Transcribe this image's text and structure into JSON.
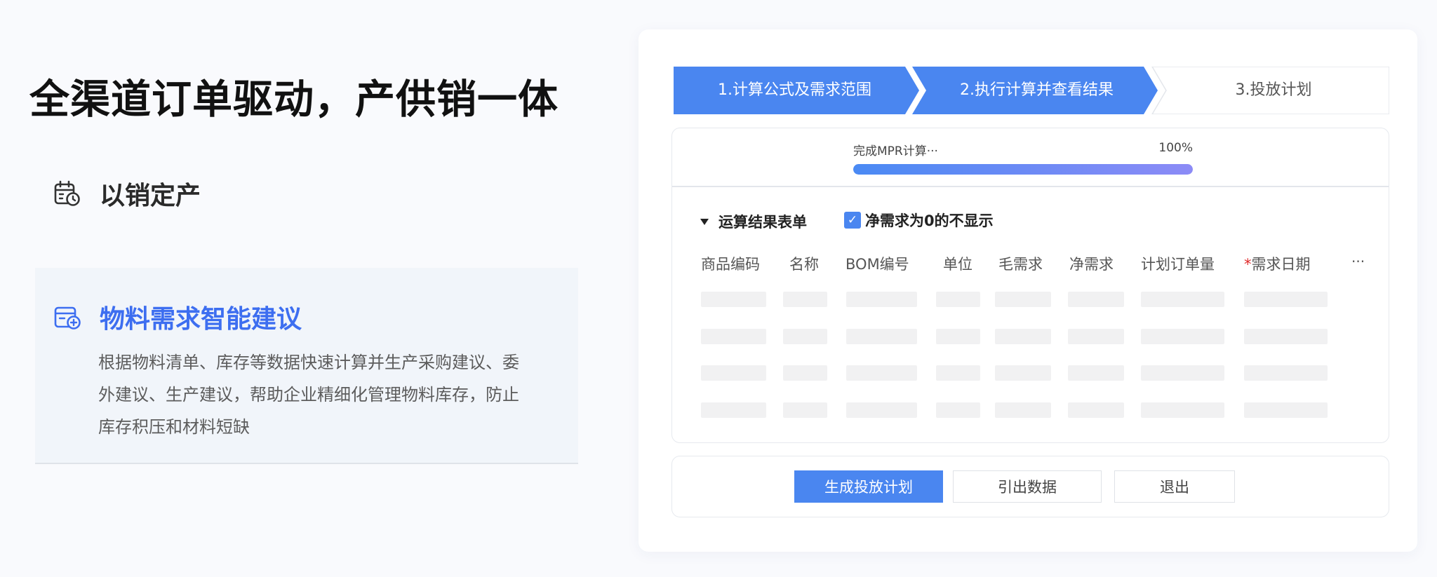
{
  "headline": "全渠道订单驱动，产供销一体",
  "features": [
    {
      "title": "以销定产",
      "icon": "calendar-clock-icon"
    },
    {
      "title": "物料需求智能建议",
      "icon": "calendar-add-icon",
      "desc": "根据物料清单、库存等数据快速计算并生产采购建议、委外建议、生产建议，帮助企业精细化管理物料库存，防止库存积压和材料短缺"
    }
  ],
  "steps": [
    "1.计算公式及需求范围",
    "2.执行计算并查看结果",
    "3.投放计划"
  ],
  "progress": {
    "label": "完成MPR计算···",
    "percent_text": "100%",
    "value": 100
  },
  "results": {
    "title": "运算结果表单",
    "checkbox_label": "净需求为0的不显示",
    "checkbox_checked": true,
    "columns": [
      "商品编码",
      "名称",
      "BOM编号",
      "单位",
      "毛需求",
      "净需求",
      "计划订单量",
      "需求日期"
    ],
    "required_mark": "*",
    "more": "···"
  },
  "buttons": {
    "generate": "生成投放计划",
    "export": "引出数据",
    "exit": "退出"
  },
  "colors": {
    "primary": "#4a86f0",
    "accent_title": "#3d6ef0",
    "progress_end": "#8c8bf6",
    "required": "#e02a2a"
  }
}
